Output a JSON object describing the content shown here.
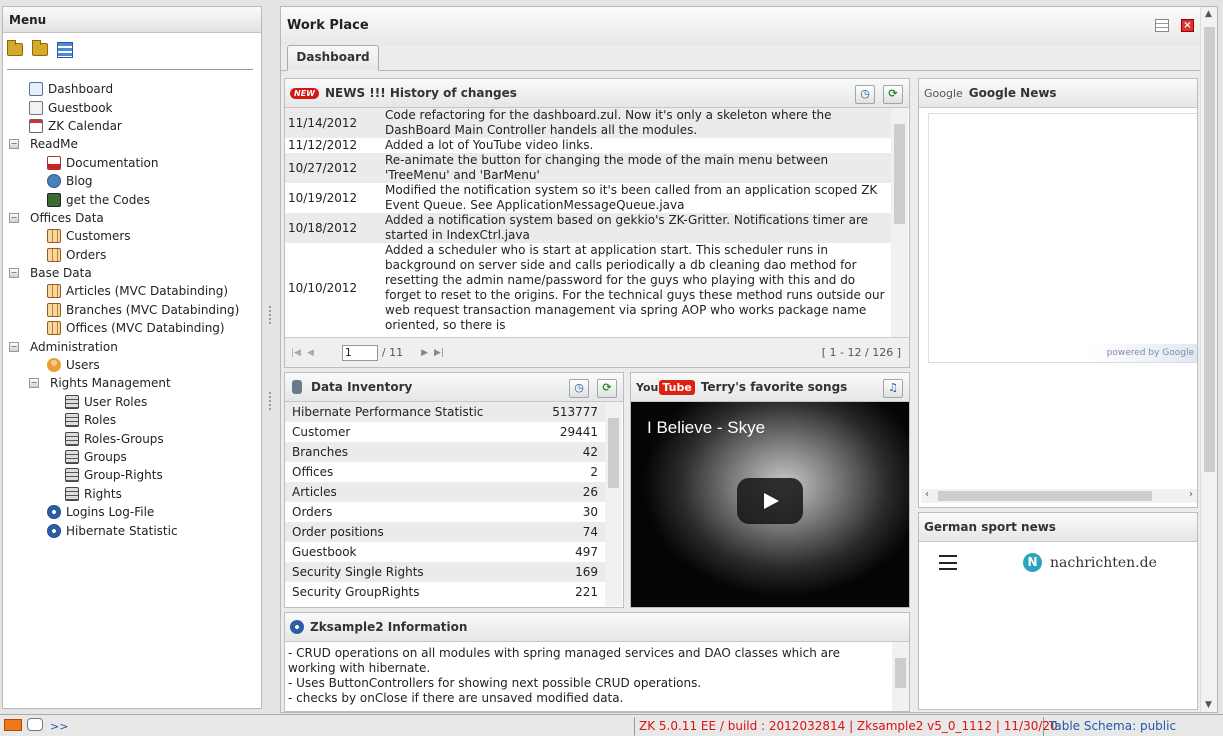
{
  "menu": {
    "title": "Menu",
    "toolbar_icons": [
      "folder-open-icon",
      "folder-closed-icon",
      "menu-style-icon"
    ],
    "tree": [
      {
        "label": "Dashboard",
        "level": 1,
        "icon": "doc"
      },
      {
        "label": "Guestbook",
        "level": 1,
        "icon": "pen"
      },
      {
        "label": "ZK Calendar",
        "level": 1,
        "icon": "cal"
      },
      {
        "label": "ReadMe",
        "level": 0,
        "group": true
      },
      {
        "label": "Documentation",
        "level": 2,
        "icon": "pdf"
      },
      {
        "label": "Blog",
        "level": 2,
        "icon": "wp"
      },
      {
        "label": "get the Codes",
        "level": 2,
        "icon": "code"
      },
      {
        "label": "Offices Data",
        "level": 0,
        "group": true
      },
      {
        "label": "Customers",
        "level": 2,
        "icon": "grid"
      },
      {
        "label": "Orders",
        "level": 2,
        "icon": "grid"
      },
      {
        "label": "Base Data",
        "level": 0,
        "group": true
      },
      {
        "label": "Articles (MVC Databinding)",
        "level": 2,
        "icon": "grid"
      },
      {
        "label": "Branches (MVC Databinding)",
        "level": 2,
        "icon": "grid"
      },
      {
        "label": "Offices (MVC Databinding)",
        "level": 2,
        "icon": "grid"
      },
      {
        "label": "Administration",
        "level": 0,
        "group": true
      },
      {
        "label": "Users",
        "level": 2,
        "icon": "user"
      },
      {
        "label": "Rights Management",
        "level": 1,
        "group": true
      },
      {
        "label": "User Roles",
        "level": 3,
        "icon": "net"
      },
      {
        "label": "Roles",
        "level": 3,
        "icon": "net"
      },
      {
        "label": "Roles-Groups",
        "level": 3,
        "icon": "net"
      },
      {
        "label": "Groups",
        "level": 3,
        "icon": "net"
      },
      {
        "label": "Group-Rights",
        "level": 3,
        "icon": "net"
      },
      {
        "label": "Rights",
        "level": 3,
        "icon": "net"
      },
      {
        "label": "Logins Log-File",
        "level": 2,
        "icon": "gear"
      },
      {
        "label": "Hibernate Statistic",
        "level": 2,
        "icon": "gear"
      }
    ]
  },
  "workplace": {
    "title": "Work Place",
    "tab": "Dashboard"
  },
  "news": {
    "title": "NEWS !!! History of changes",
    "badge": "NEW",
    "rows": [
      {
        "date": "11/14/2012",
        "text": "Code refactoring for the dashboard.zul. Now it's only a skeleton where the DashBoard Main Controller handels all the modules."
      },
      {
        "date": "11/12/2012",
        "text": "Added a lot of YouTube video links."
      },
      {
        "date": "10/27/2012",
        "text": "Re-animate the button for changing the mode of the main menu between 'TreeMenu' and 'BarMenu'"
      },
      {
        "date": "10/19/2012",
        "text": "Modified the notification system so it's been called from an application scoped ZK Event Queue. See ApplicationMessageQueue.java"
      },
      {
        "date": "10/18/2012",
        "text": "Added a notification system based on gekkio's ZK-Gritter. Notifications timer are started in IndexCtrl.java"
      },
      {
        "date": "10/10/2012",
        "text": "Added a scheduler who is start at application start. This scheduler runs in background on server side and calls periodically a db cleaning dao method for resetting the admin name/password for the guys who playing with this and do forget to reset to the origins. For the technical guys these method runs outside our web request transaction management via spring AOP who works package name oriented, so there is"
      }
    ],
    "pager": {
      "page": "1",
      "total": "/ 11",
      "count": "[ 1 - 12 / 126 ]"
    }
  },
  "google_news": {
    "title": "Google News",
    "brand": "Google",
    "powered": "powered by Google"
  },
  "sport_news": {
    "title": "German sport news",
    "logo_text": "nachrichten.de",
    "logo_letter": "N"
  },
  "inventory": {
    "title": "Data Inventory",
    "rows": [
      {
        "name": "Hibernate Performance Statistic",
        "value": "513777"
      },
      {
        "name": "Customer",
        "value": "29441"
      },
      {
        "name": "Branches",
        "value": "42"
      },
      {
        "name": "Offices",
        "value": "2"
      },
      {
        "name": "Articles",
        "value": "26"
      },
      {
        "name": "Orders",
        "value": "30"
      },
      {
        "name": "Order positions",
        "value": "74"
      },
      {
        "name": "Guestbook",
        "value": "497"
      },
      {
        "name": "Security Single Rights",
        "value": "169"
      },
      {
        "name": "Security GroupRights",
        "value": "221"
      }
    ]
  },
  "youtube": {
    "title": "Terry's favorite songs",
    "logo_you": "You",
    "logo_tube": "Tube",
    "video_title": "I Believe - Skye"
  },
  "info": {
    "title": "Zksample2 Information",
    "lines": [
      "- CRUD operations on all modules with spring managed services and DAO classes which are working with hibernate.",
      "- Uses ButtonControllers for showing next possible CRUD operations.",
      "- checks by onClose if there are unsaved modified data."
    ]
  },
  "status": {
    "more": ">>",
    "version": "ZK 5.0.11 EE / build : 2012032814 | Zksample2 v5_0_1112 | 11/30/20",
    "schema": "Table Schema: public"
  }
}
